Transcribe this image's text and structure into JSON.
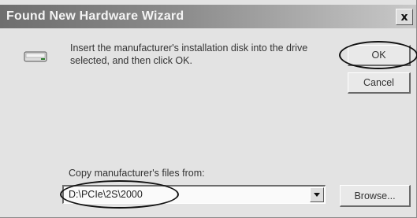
{
  "window": {
    "title": "Found New Hardware Wizard",
    "close_symbol": "x"
  },
  "dialog": {
    "icon": "disk-drive-icon",
    "message": "Insert the manufacturer's installation disk into the drive selected, and then click OK.",
    "ok_label": "OK",
    "cancel_label": "Cancel",
    "copy_label": "Copy manufacturer's files from:",
    "path_value": "D:\\PCIe\\2S\\2000",
    "browse_label": "Browse..."
  },
  "colors": {
    "titlebar_start": "#6e6e6e",
    "titlebar_end": "#c9c9c9",
    "dialog_bg": "#e3e3e3",
    "annotation": "#111111"
  }
}
